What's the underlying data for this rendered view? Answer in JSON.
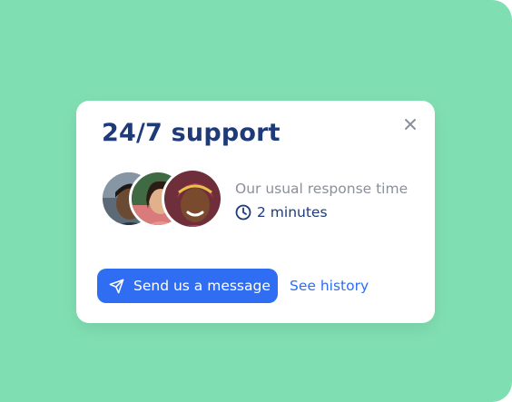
{
  "widget": {
    "title": "24/7 support",
    "response_label": "Our usual response time",
    "response_time": "2 minutes",
    "primary_button_label": "Send us a message",
    "secondary_link_label": "See history"
  },
  "icons": {
    "close": "close-icon",
    "clock": "clock-icon",
    "send": "paper-plane-icon"
  },
  "colors": {
    "background": "#80DFB2",
    "card": "#FFFFFF",
    "title": "#1E3A78",
    "accent": "#2F6DF2",
    "muted_text": "#8A8F99"
  }
}
